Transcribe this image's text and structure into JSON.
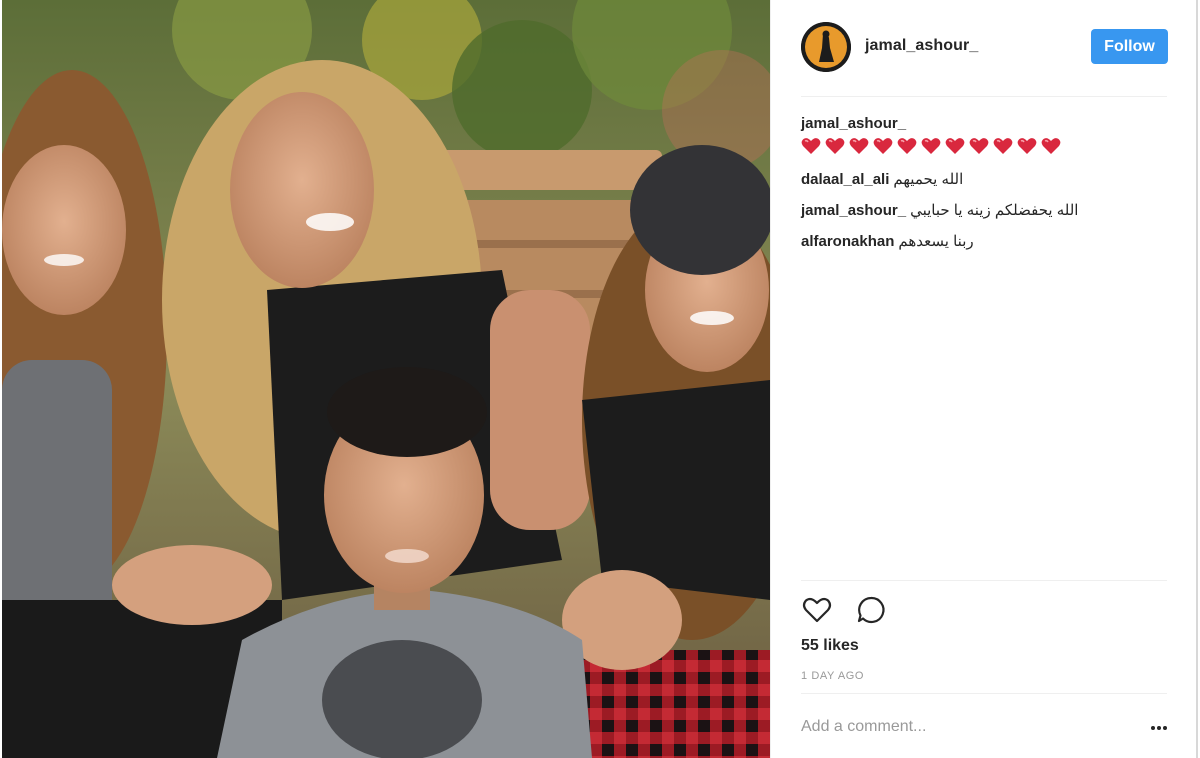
{
  "post": {
    "username": "jamal_ashour_",
    "follow_label": "Follow",
    "caption": {
      "user": "jamal_ashour_",
      "hearts": [
        "red-heart-emoji",
        "red-heart-emoji",
        "red-heart-emoji",
        "red-heart-emoji",
        "red-heart-emoji",
        "red-heart-emoji",
        "red-heart-emoji",
        "red-heart-emoji",
        "red-heart-emoji",
        "red-heart-emoji",
        "red-heart-emoji"
      ]
    },
    "comments": [
      {
        "user": "dalaal_al_ali",
        "text": "الله يحميهم"
      },
      {
        "user": "jamal_ashour_",
        "text": "الله يحفضلكم زينه يا حبايبي"
      },
      {
        "user": "alfaronakhan",
        "text": "ربنا يسعدهم"
      }
    ],
    "likes": "55 likes",
    "time_ago": "1 DAY AGO",
    "comment_placeholder": "Add a comment...",
    "icons": {
      "like": "heart-outline-icon",
      "comment": "speech-bubble-icon",
      "more": "ellipsis-icon"
    }
  },
  "colors": {
    "follow_button": "#3897f0",
    "heart_emoji": "#d9283e"
  }
}
